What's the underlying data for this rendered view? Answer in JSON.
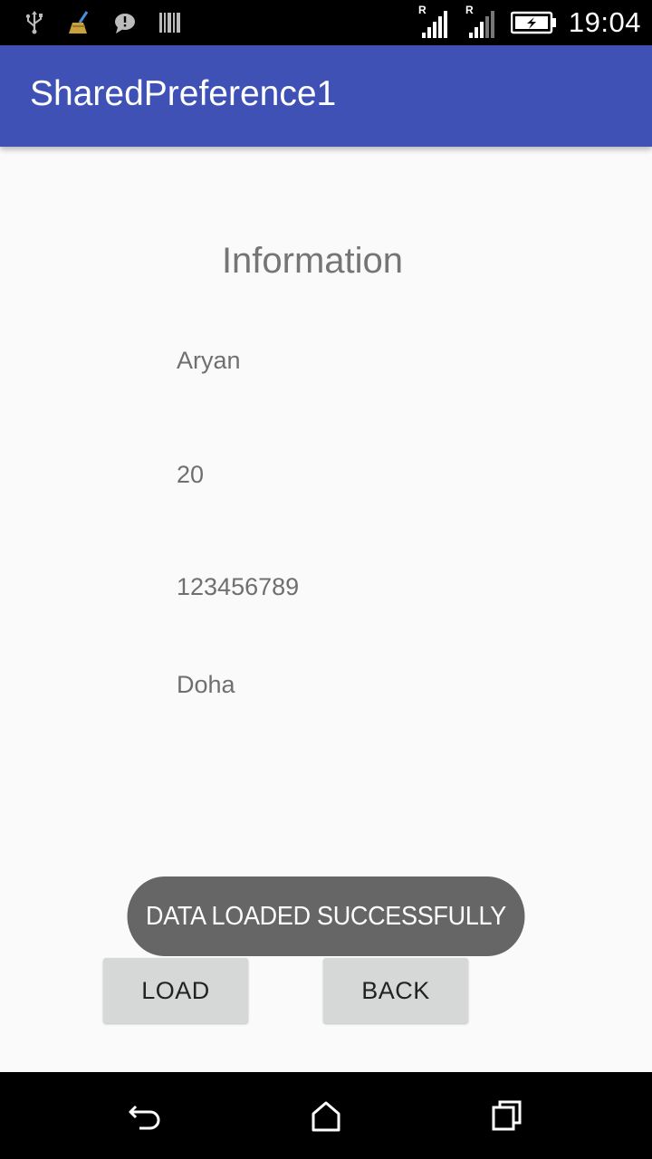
{
  "status_bar": {
    "time": "19:04",
    "left_icons": [
      "usb-icon",
      "cleaner-icon",
      "message-icon",
      "barcode-icon"
    ],
    "right_icons": [
      "signal-1-icon",
      "signal-2-icon",
      "battery-charging-icon"
    ],
    "roaming_label": "R"
  },
  "app_bar": {
    "title": "SharedPreference1",
    "color": "#3f51b5"
  },
  "content": {
    "heading": "Information",
    "fields": {
      "name": "Aryan",
      "age": "20",
      "phone": "123456789",
      "city": "Doha"
    }
  },
  "toast": {
    "message": "DATA LOADED SUCCESSFULLY"
  },
  "buttons": {
    "load_label": "LOAD",
    "back_label": "BACK"
  },
  "nav_bar": {
    "items": [
      "back-icon",
      "home-icon",
      "recents-icon"
    ]
  }
}
